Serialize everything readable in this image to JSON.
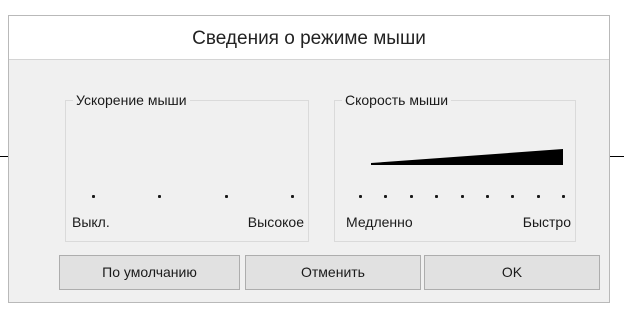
{
  "dialog": {
    "title": "Сведения о режиме мыши"
  },
  "acceleration": {
    "group_title": "Ускорение мыши",
    "tick_count": 4,
    "label_left": "Выкл.",
    "label_right": "Высокое"
  },
  "speed": {
    "group_title": "Скорость мыши",
    "tick_count": 9,
    "label_left": "Медленно",
    "label_right": "Быстро"
  },
  "buttons": {
    "default_label": "По умолчанию",
    "cancel_label": "Отменить",
    "ok_label": "OK"
  }
}
